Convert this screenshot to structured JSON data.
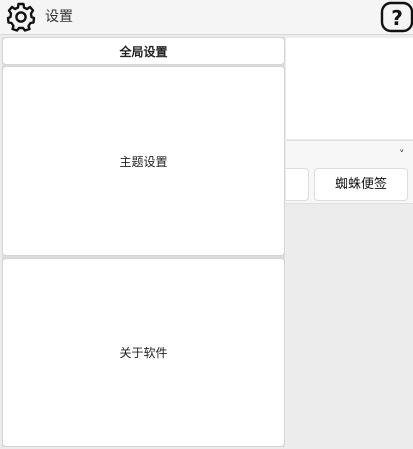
{
  "header": {
    "title": "设置",
    "icon_left": "gear-icon",
    "icon_right": "help-icon"
  },
  "menu": {
    "items": [
      {
        "label": "全局设置"
      },
      {
        "label": "主题设置"
      },
      {
        "label": "关于软件"
      }
    ]
  },
  "background": {
    "button_label": "蜘蛛便签",
    "chevron": "˅"
  }
}
